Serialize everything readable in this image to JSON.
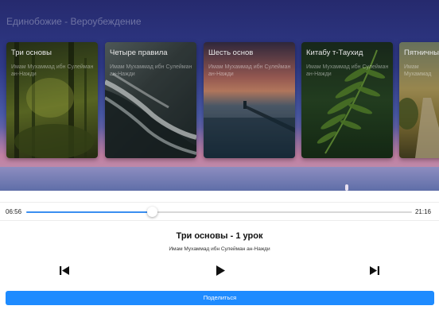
{
  "section": {
    "title": "Единобожие - Вероубеждение"
  },
  "cards": [
    {
      "title": "Три основы",
      "subtitle": "Имам Мухаммад ибн Сулейман ан-Нажди"
    },
    {
      "title": "Четыре правила",
      "subtitle": "Имам Мухаммад ибн Сулейман ан-Нажди"
    },
    {
      "title": "Шесть основ",
      "subtitle": "Имам Мухаммад ибн Сулейман ан-Нажди"
    },
    {
      "title": "Китабу т-Таухид",
      "subtitle": "Имам Мухаммад ибн Сулейман ан-Нажди"
    },
    {
      "title": "Пятничные",
      "subtitle": "Имам Мухаммад"
    }
  ],
  "player": {
    "current_time": "06:56",
    "total_time": "21:16",
    "progress": 0.326,
    "track_title": "Три основы - 1 урок",
    "track_author": "Имам Мухаммад ибн Сулейман ан-Нажди",
    "share_label": "Поделиться",
    "accent_color": "#1e8bff"
  },
  "icons": {
    "previous": "skip-previous-icon",
    "play": "play-icon",
    "next": "skip-next-icon"
  }
}
